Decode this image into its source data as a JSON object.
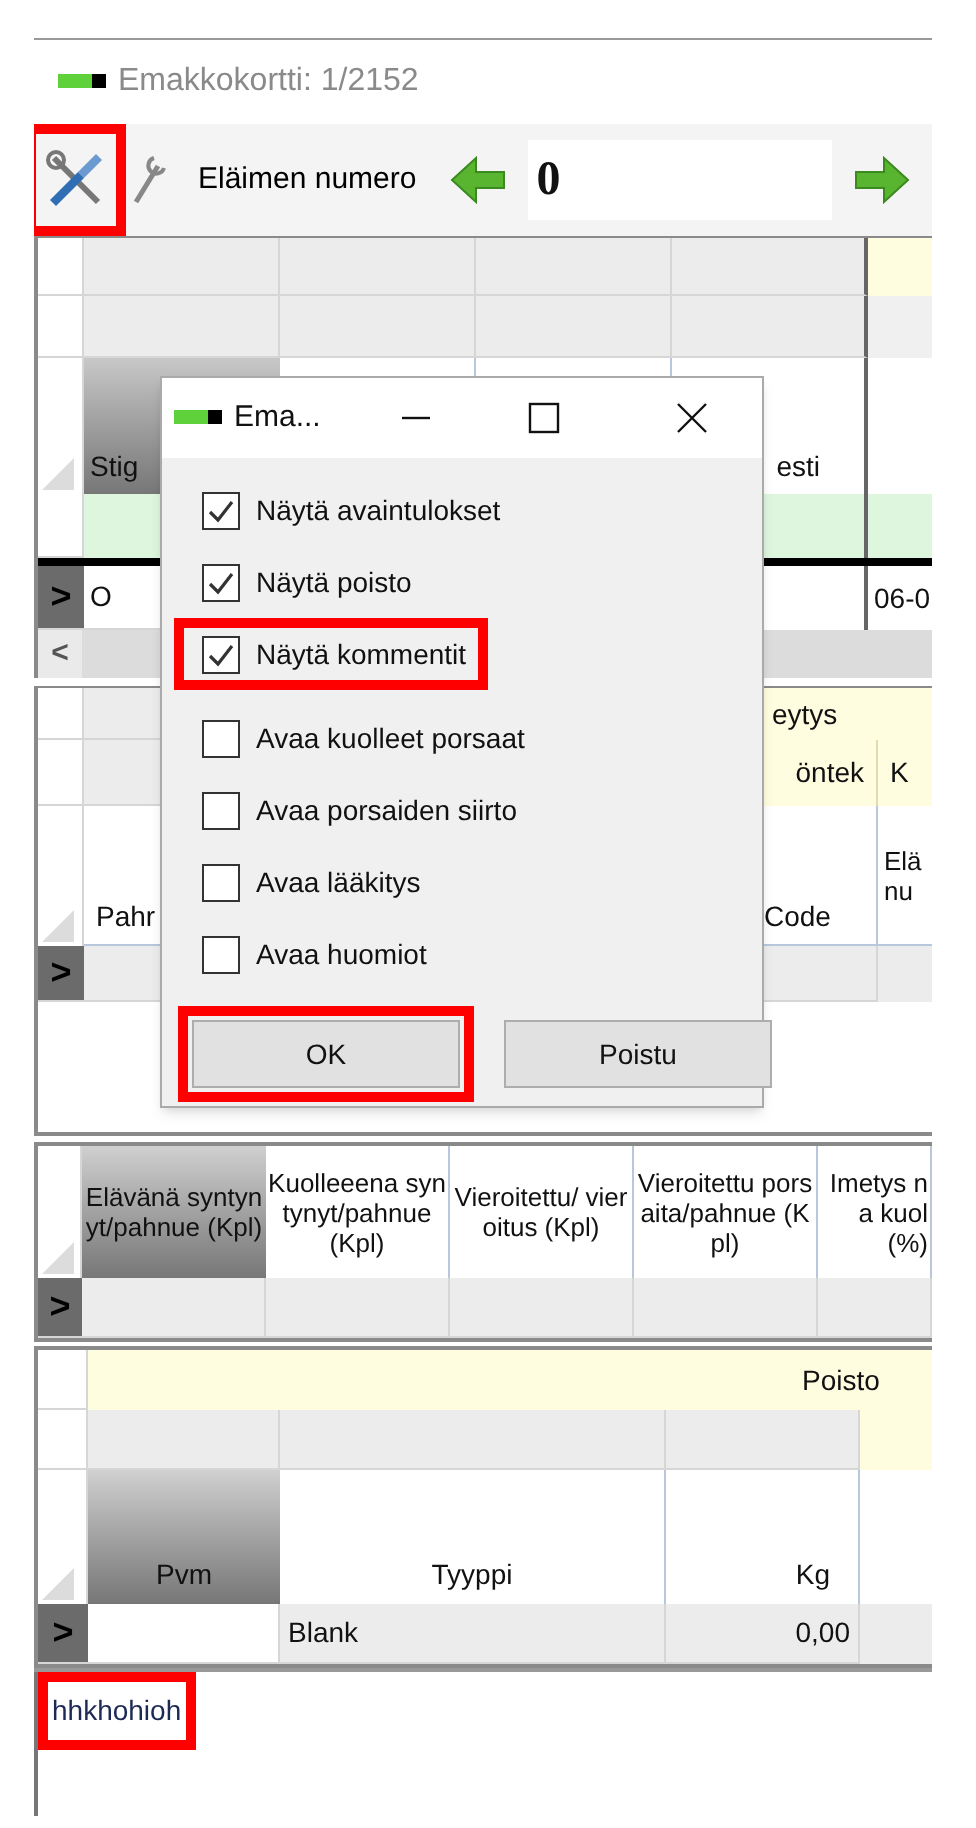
{
  "window": {
    "title": "Emakkokortti: 1/2152"
  },
  "toolbar": {
    "tools_highlighted": true,
    "label": "Eläimen numero",
    "number": "0"
  },
  "main_grid": {
    "column_1_header": "Stig",
    "column_4_header": "esti",
    "row": {
      "column_1": "O",
      "column_5": "06-0"
    },
    "scroll_left": "<",
    "row_marker": ">"
  },
  "second_grid": {
    "group_header": "eytys",
    "column_4_subheader": "öntek",
    "column_5_subheader": "K",
    "column_1_header": "Pahr",
    "column_4_header": "Code",
    "column_5_header": "Elä nu",
    "row_marker": ">"
  },
  "third_grid": {
    "columns": [
      {
        "label": "Elävänä syntynyt/pahnue (Kpl)",
        "selected": true
      },
      {
        "label": "Kuolleeena syntynyt/pahnue (Kpl)",
        "selected": false
      },
      {
        "label": "Vieroitettu/ vieroitus (Kpl)",
        "selected": false
      },
      {
        "label": "Vieroitettu porsaita/pahnue (Kpl)",
        "selected": false
      },
      {
        "label": "Imetys na kuol (%)",
        "selected": false
      }
    ],
    "row_marker": ">"
  },
  "removal_grid": {
    "group_header": "Poisto",
    "columns": [
      {
        "label": "Pvm",
        "selected": true
      },
      {
        "label": "Tyyppi",
        "selected": false
      },
      {
        "label": "Kg",
        "selected": false
      }
    ],
    "row": {
      "tyyppi": "Blank",
      "kg": "0,00"
    },
    "row_marker": ">"
  },
  "comment": {
    "text": "hhkhohioh",
    "highlighted": true
  },
  "dialog": {
    "title": "Ema...",
    "options": [
      {
        "label": "Näytä avaintulokset",
        "checked": true,
        "highlighted": false
      },
      {
        "label": "Näytä poisto",
        "checked": true,
        "highlighted": false
      },
      {
        "label": "Näytä kommentit",
        "checked": true,
        "highlighted": true
      },
      {
        "label": "Avaa kuolleet porsaat",
        "checked": false,
        "highlighted": false
      },
      {
        "label": "Avaa porsaiden siirto",
        "checked": false,
        "highlighted": false
      },
      {
        "label": "Avaa lääkitys",
        "checked": false,
        "highlighted": false
      },
      {
        "label": "Avaa huomiot",
        "checked": false,
        "highlighted": false
      }
    ],
    "buttons": [
      {
        "label": "OK",
        "highlighted": true
      },
      {
        "label": "Poistu",
        "highlighted": false
      }
    ]
  }
}
